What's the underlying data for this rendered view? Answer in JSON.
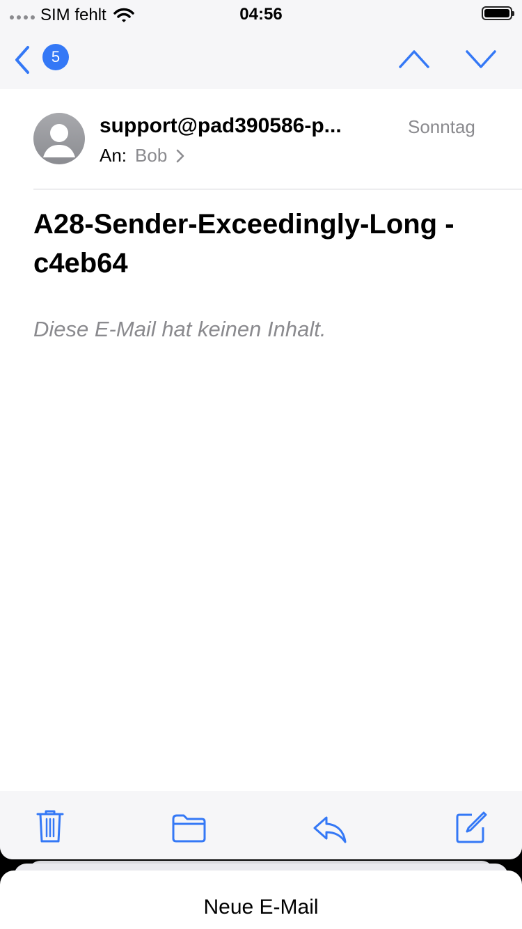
{
  "status_bar": {
    "carrier": "SIM fehlt",
    "time": "04:56"
  },
  "nav": {
    "badge_count": "5"
  },
  "message": {
    "sender": "support@pad390586-p...",
    "date": "Sonntag",
    "to_label": "An:",
    "recipient": "Bob",
    "subject": "A28-Sender-Exceedingly-Long - c4eb64",
    "body_placeholder": "Diese E-Mail hat keinen Inhalt."
  },
  "draft": {
    "title": "Neue E-Mail"
  },
  "colors": {
    "accent": "#3478f6",
    "secondary_text": "#8a8a8e"
  },
  "icons": [
    "back-icon",
    "chevron-up-icon",
    "chevron-down-icon",
    "trash-icon",
    "folder-icon",
    "reply-icon",
    "compose-icon",
    "wifi-icon",
    "battery-icon",
    "signal-dots-icon",
    "person-icon",
    "chevron-right-icon"
  ]
}
